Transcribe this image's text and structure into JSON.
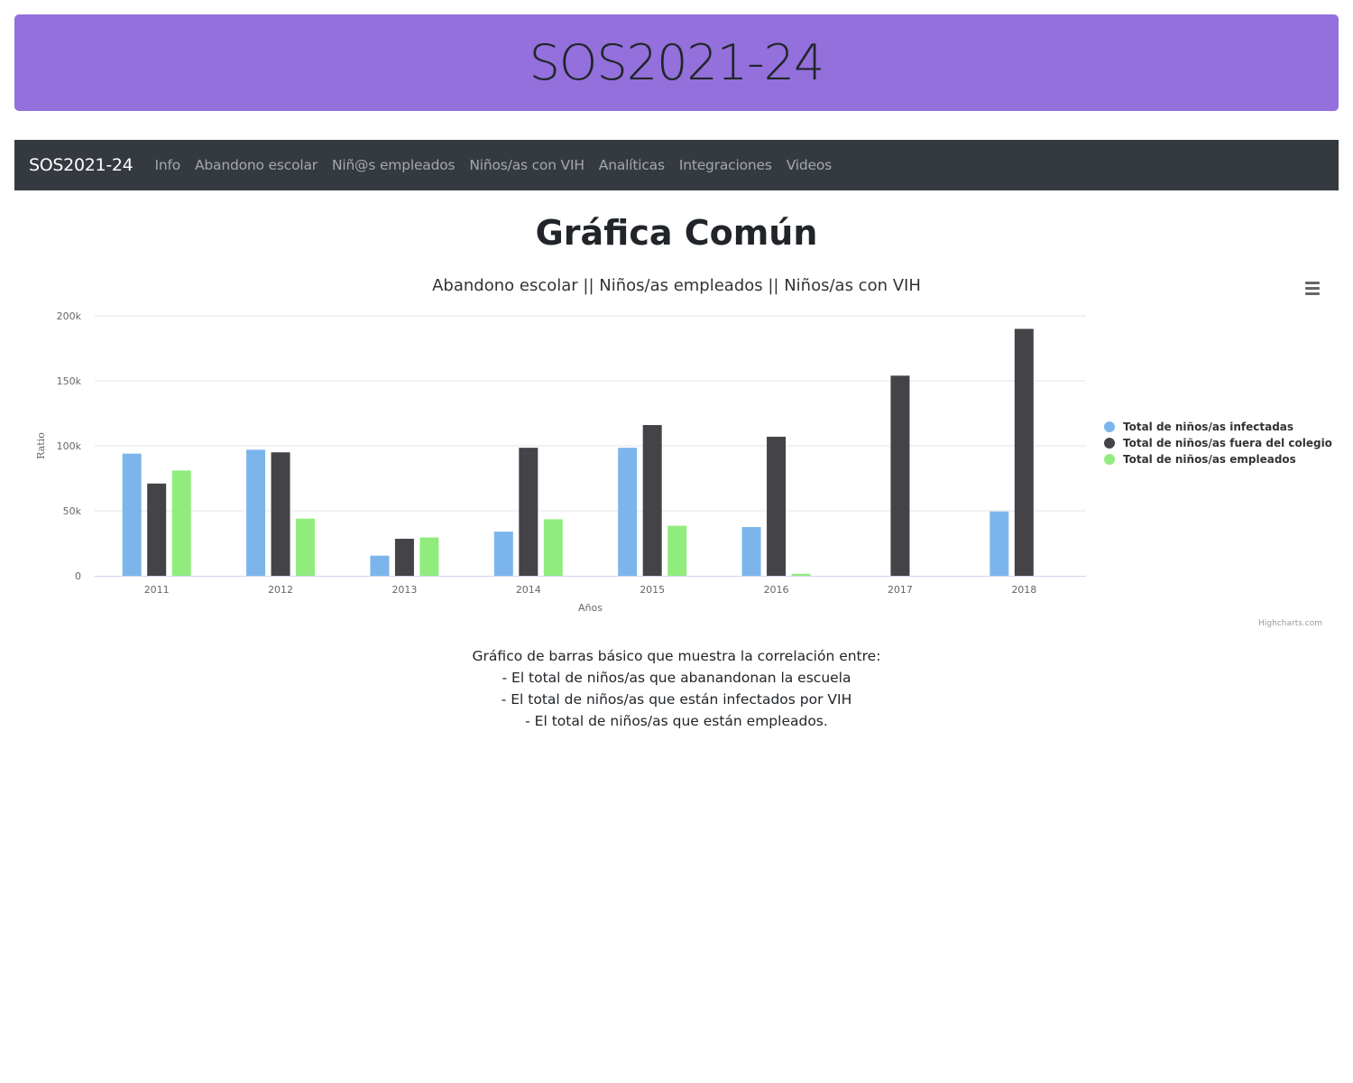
{
  "banner": {
    "title": "SOS2021-24"
  },
  "navbar": {
    "brand": "SOS2021-24",
    "links": [
      "Info",
      "Abandono escolar",
      "Niñ@s empleados",
      "Niños/as con VIH",
      "Analíticas",
      "Integraciones",
      "Videos"
    ]
  },
  "page": {
    "title": "Gráfica Común"
  },
  "chart": {
    "title": "Abandono escolar || Niños/as empleados || Niños/as con VIH",
    "credits": "Highcharts.com",
    "menu_icon": "hamburger-menu-icon"
  },
  "chart_data": {
    "type": "bar",
    "title": "Abandono escolar || Niños/as empleados || Niños/as con VIH",
    "xlabel": "Años",
    "ylabel": "Ratio",
    "categories": [
      "2011",
      "2012",
      "2013",
      "2014",
      "2015",
      "2016",
      "2017",
      "2018"
    ],
    "ylim": [
      0,
      200000
    ],
    "yticks": [
      0,
      50000,
      100000,
      150000,
      200000
    ],
    "ytick_labels": [
      "0",
      "50k",
      "100k",
      "150k",
      "200k"
    ],
    "grid": true,
    "legend_position": "right",
    "series": [
      {
        "name": "Total de niños/as infectadas",
        "color": "#7cb5ec",
        "values": [
          94000,
          97000,
          15500,
          34000,
          98500,
          37500,
          null,
          49500
        ]
      },
      {
        "name": "Total de niños/as fuera del colegio",
        "color": "#434348",
        "values": [
          71000,
          95000,
          28500,
          98500,
          116000,
          107000,
          154000,
          190000
        ]
      },
      {
        "name": "Total de niños/as empleados",
        "color": "#90ed7d",
        "values": [
          81000,
          44000,
          29500,
          43500,
          38500,
          1500,
          null,
          null
        ]
      }
    ]
  },
  "description": {
    "lines": [
      "Gráfico de barras básico que muestra la correlación entre:",
      "- El total de niños/as que abanandonan la escuela",
      "- El total de niños/as que están infectados por VIH",
      "- El total de niños/as que están empleados."
    ]
  }
}
